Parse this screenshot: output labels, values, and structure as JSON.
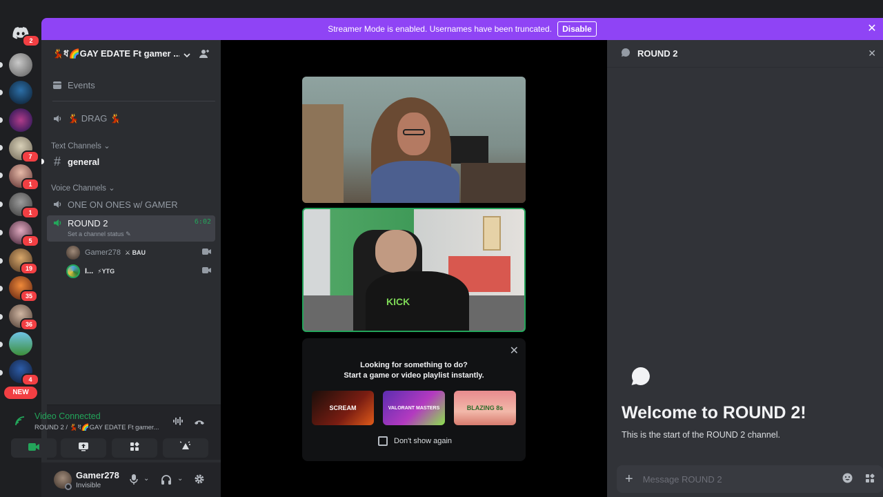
{
  "streamer_bar": {
    "message": "Streamer Mode is enabled. Usernames have been truncated.",
    "disable_label": "Disable"
  },
  "rail": {
    "home_badge": "2",
    "badges": [
      {
        "value": "7"
      },
      {
        "value": "1"
      },
      {
        "value": "1"
      },
      {
        "value": "5"
      },
      {
        "value": "19"
      },
      {
        "value": "35"
      },
      {
        "value": "36"
      },
      {
        "value": "4"
      }
    ],
    "new_label": "NEW"
  },
  "sidebar": {
    "server_name": "💃ধ🌈GAY EDATE Ft gamer ...",
    "events_label": "Events",
    "drag_label": "💃 DRAG 💃",
    "text_category": "Text Channels",
    "general_label": "general",
    "voice_category": "Voice Channels",
    "one_on_ones_label": "ONE ON ONES w/ GAMER",
    "round2_label": "ROUND 2",
    "round2_timer": "6:02",
    "channel_status_placeholder": "Set a channel status",
    "voice_users": [
      {
        "name": "Gamer278",
        "tag": "BAU"
      },
      {
        "name": "I...",
        "tag": "YTG"
      }
    ]
  },
  "voice_panel": {
    "status": "Video Connected",
    "location": "ROUND 2 / 💃ধ🌈GAY EDATE Ft gamer..."
  },
  "user_bar": {
    "username": "Gamer278",
    "status": "Invisible"
  },
  "activity": {
    "line1": "Looking for something to do?",
    "line2": "Start a game or video playlist instantly.",
    "dont_show": "Don't show again",
    "games": [
      "SCREAM",
      "VALORANT MASTERS",
      "BLAZING 8s"
    ]
  },
  "chat": {
    "channel_name": "ROUND 2",
    "welcome_title": "Welcome to ROUND 2!",
    "welcome_sub": "This is the start of the ROUND 2 channel.",
    "composer_placeholder": "Message ROUND 2"
  },
  "colors": {
    "accent_purple": "#8f44f5",
    "online_green": "#23a55a",
    "danger_red": "#f23f43",
    "panel_bg": "#2b2d31"
  }
}
